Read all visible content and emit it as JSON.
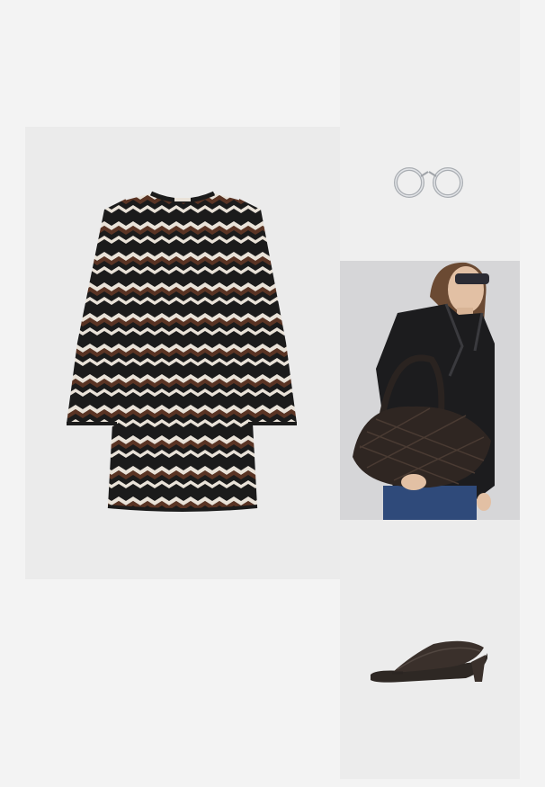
{
  "board": {
    "items": [
      {
        "name": "knit-dress",
        "colors": [
          "#1b1b1b",
          "#5a3424",
          "#e9e2d8"
        ]
      },
      {
        "name": "hoop-earrings",
        "colors": [
          "#b9bcc0"
        ]
      },
      {
        "name": "model-leather-jacket-woven-bag",
        "colors": [
          "#1c1c1e",
          "#2f2622",
          "#2f4a7a"
        ]
      },
      {
        "name": "heeled-thong-sandal",
        "colors": [
          "#3a302b"
        ]
      }
    ]
  }
}
